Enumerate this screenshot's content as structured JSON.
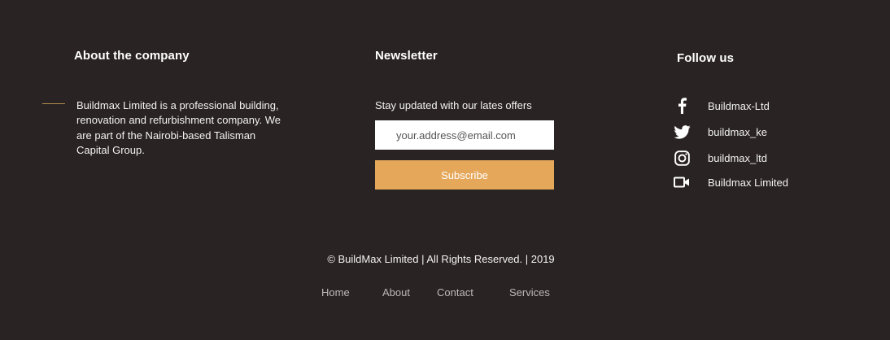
{
  "about": {
    "heading": "About the company",
    "text": "Buildmax Limited is a professional building, renovation and refurbishment company. We are part of the Nairobi-based Talisman Capital Group."
  },
  "newsletter": {
    "heading": "Newsletter",
    "subtitle": "Stay updated with our lates offers",
    "email_placeholder": "your.address@email.com",
    "subscribe_label": "Subscribe"
  },
  "social": {
    "heading": "Follow us",
    "items": [
      {
        "icon": "facebook-icon",
        "label": "Buildmax-Ltd"
      },
      {
        "icon": "twitter-icon",
        "label": "buildmax_ke"
      },
      {
        "icon": "instagram-icon",
        "label": "buildmax_ltd"
      },
      {
        "icon": "video-camera-icon",
        "label": "Buildmax Limited"
      }
    ]
  },
  "footer": {
    "copyright": "© BuildMax Limited | All Rights Reserved. | 2019",
    "links": [
      "Home",
      "About",
      "Contact",
      "Services"
    ]
  },
  "colors": {
    "background": "#2a2323",
    "accent": "#e5a75a",
    "divider": "#b08a4c"
  }
}
